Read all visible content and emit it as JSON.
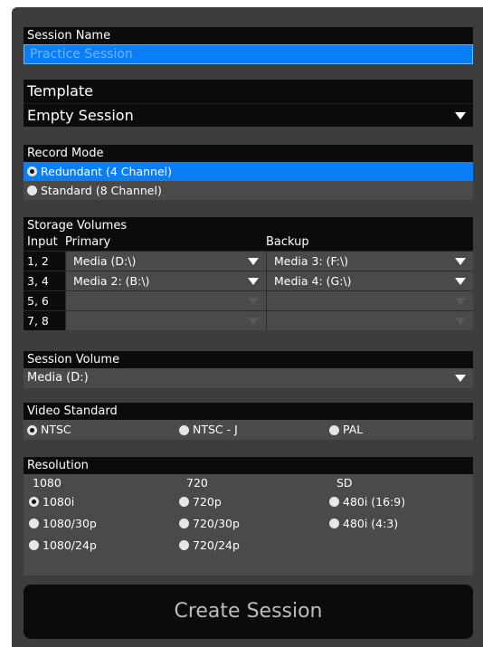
{
  "session_name": {
    "label": "Session Name",
    "value": "Practice Session"
  },
  "template": {
    "label": "Template",
    "selected": "Empty Session"
  },
  "record_mode": {
    "label": "Record Mode",
    "options": [
      {
        "label": "Redundant (4 Channel)",
        "selected": true
      },
      {
        "label": "Standard (8 Channel)",
        "selected": false
      }
    ]
  },
  "storage": {
    "label": "Storage Volumes",
    "headers": {
      "input": "Input",
      "primary": "Primary",
      "backup": "Backup"
    },
    "rows": [
      {
        "input": "1, 2",
        "primary": "Media (D:\\)",
        "backup": "Media 3: (F:\\)",
        "enabled": true
      },
      {
        "input": "3, 4",
        "primary": "Media 2: (B:\\)",
        "backup": "Media 4: (G:\\)",
        "enabled": true
      },
      {
        "input": "5, 6",
        "primary": "",
        "backup": "",
        "enabled": false
      },
      {
        "input": "7, 8",
        "primary": "",
        "backup": "",
        "enabled": false
      }
    ]
  },
  "session_volume": {
    "label": "Session Volume",
    "selected": "Media (D:)"
  },
  "video_standard": {
    "label": "Video Standard",
    "options": [
      {
        "label": "NTSC",
        "selected": true
      },
      {
        "label": "NTSC - J",
        "selected": false
      },
      {
        "label": "PAL",
        "selected": false
      }
    ]
  },
  "resolution": {
    "label": "Resolution",
    "columns": [
      {
        "header": "1080",
        "options": [
          {
            "label": "1080i",
            "selected": true
          },
          {
            "label": "1080/30p",
            "selected": false
          },
          {
            "label": "1080/24p",
            "selected": false
          }
        ]
      },
      {
        "header": "720",
        "options": [
          {
            "label": "720p",
            "selected": false
          },
          {
            "label": "720/30p",
            "selected": false
          },
          {
            "label": "720/24p",
            "selected": false
          }
        ]
      },
      {
        "header": "SD",
        "options": [
          {
            "label": "480i (16:9)",
            "selected": false
          },
          {
            "label": "480i (4:3)",
            "selected": false
          }
        ]
      }
    ]
  },
  "create_button": {
    "label": "Create Session"
  }
}
